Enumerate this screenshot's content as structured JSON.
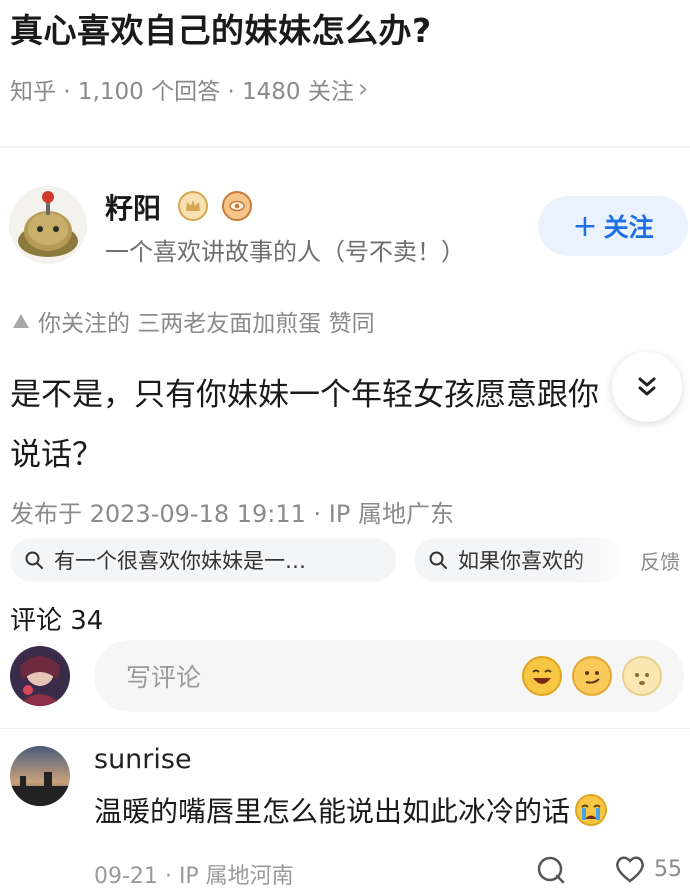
{
  "question": {
    "title": "真心喜欢自己的妹妹怎么办?",
    "meta": "知乎 · 1,100 个回答 · 1480 关注",
    "meta_chevron": "›"
  },
  "author": {
    "name": "籽阳",
    "bio": "一个喜欢讲故事的人（号不卖！）",
    "follow_label": "关注",
    "follow_plus": "+"
  },
  "voters": {
    "text": "你关注的 三两老友面加煎蛋 赞同"
  },
  "answer": {
    "line1": "是不是，只有你妹妹一个年轻女孩愿意跟你",
    "line2": "说话？",
    "published": "发布于 2023-09-18 19:11 · IP 属地广东"
  },
  "related_searches": [
    {
      "label": "有一个很喜欢你妹妹是一…"
    },
    {
      "label": "如果你喜欢的"
    }
  ],
  "feedback_label": "反馈",
  "comments": {
    "header": "评论 34",
    "input_placeholder": "写评论",
    "items": [
      {
        "user": "sunrise",
        "text": "温暖的嘴唇里怎么能说出如此冰冷的话",
        "date": "09-21",
        "ip": "IP 属地河南",
        "likes": "55"
      }
    ]
  },
  "colors": {
    "accent": "#1e6fe8",
    "follow_bg": "#eaf2fd",
    "muted": "#8a8a8a"
  },
  "icons": [
    "chevron-right-icon",
    "vip-badge-icon",
    "creator-badge-icon",
    "triangle-up-icon",
    "chevron-double-down-icon",
    "search-icon",
    "laugh-emoji-icon",
    "smirk-emoji-icon",
    "question-emoji-icon",
    "crying-emoji-icon",
    "reply-icon",
    "heart-icon"
  ]
}
